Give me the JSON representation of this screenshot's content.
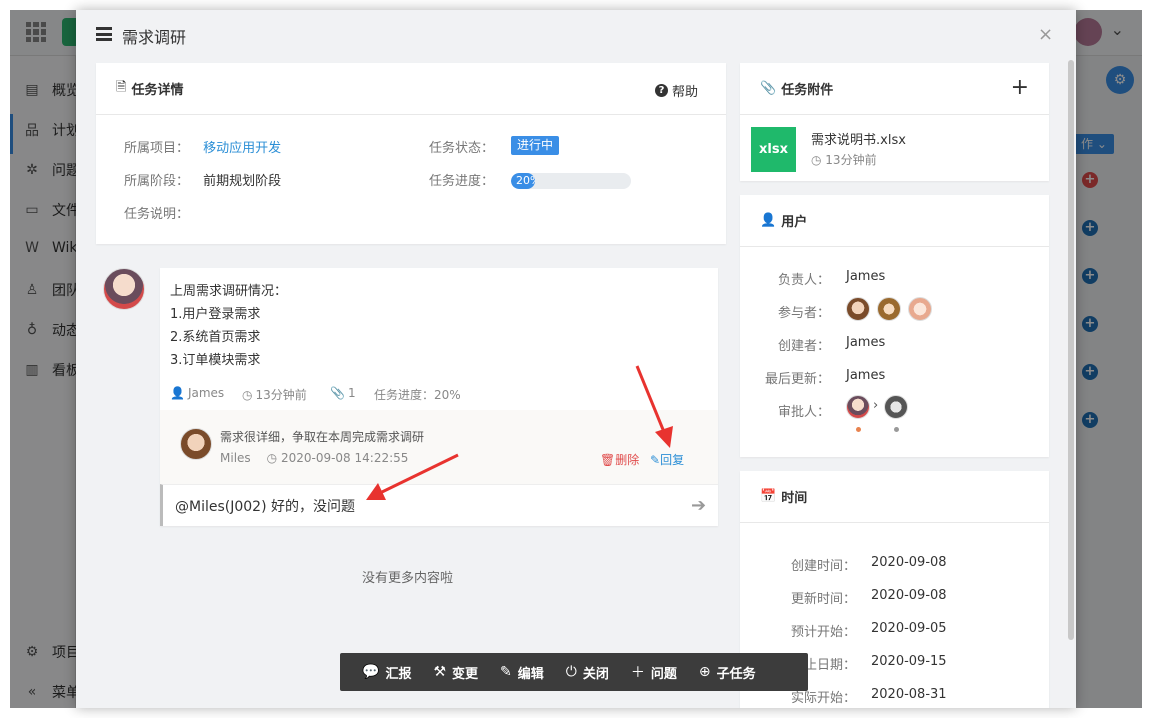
{
  "background_app": {
    "sidebar_items": [
      "概览",
      "计划",
      "问题",
      "文件",
      "Wiki",
      "团队",
      "动态",
      "看板"
    ],
    "footer_items": [
      "项目",
      "菜单"
    ],
    "operation_button": "作"
  },
  "modal": {
    "title": "需求调研",
    "close_symbol": "×"
  },
  "task_detail": {
    "heading": "任务详情",
    "help_label": "帮助",
    "project_label": "所属项目：",
    "project_value": "移动应用开发",
    "stage_label": "所属阶段：",
    "stage_value": "前期规划阶段",
    "desc_label": "任务说明：",
    "status_label": "任务状态：",
    "status_value": "进行中",
    "progress_label": "任务进度：",
    "progress_text": "20%",
    "progress_fraction": 0.2
  },
  "comment": {
    "lines": [
      "上周需求调研情况：",
      "1.用户登录需求",
      "2.系统首页需求",
      "3.订单模块需求"
    ],
    "author": "James",
    "time": "13分钟前",
    "attachment_count": "1",
    "progress_note": "任务进度：20%",
    "reply": {
      "text": "需求很详细，争取在本周完成需求调研",
      "author": "Miles",
      "time": "2020-09-08 14:22:55",
      "delete_label": "删除",
      "reply_label": "回复"
    },
    "input_value": "@Miles(J002) 好的，没问题"
  },
  "no_more": "没有更多内容啦",
  "attachments": {
    "heading": "任务附件",
    "add_symbol": "+",
    "file_type": "xlsx",
    "file_name": "需求说明书.xlsx",
    "file_time": "13分钟前"
  },
  "users": {
    "heading": "用户",
    "owner_label": "负责人：",
    "owner": "James",
    "participants_label": "参与者：",
    "creator_label": "创建者：",
    "creator": "James",
    "updater_label": "最后更新：",
    "updater": "James",
    "approver_label": "审批人：",
    "approver_arrow": "›"
  },
  "times": {
    "heading": "时间",
    "created_label": "创建时间：",
    "created": "2020-09-08",
    "updated_label": "更新时间：",
    "updated": "2020-09-08",
    "planned_start_label": "预计开始：",
    "planned_start": "2020-09-05",
    "deadline_label": "截止日期：",
    "deadline": "2020-09-15",
    "actual_start_label": "实际开始：",
    "actual_start": "2020-08-31"
  },
  "toolbar": {
    "report": "汇报",
    "change": "变更",
    "edit": "编辑",
    "close": "关闭",
    "issue": "问题",
    "subtask": "子任务"
  },
  "colors": {
    "accent": "#3a8ee6",
    "link": "#2c8fd6",
    "danger": "#e04b4b",
    "excel": "#1fb96b",
    "annotation_arrow": "#e8332f"
  }
}
